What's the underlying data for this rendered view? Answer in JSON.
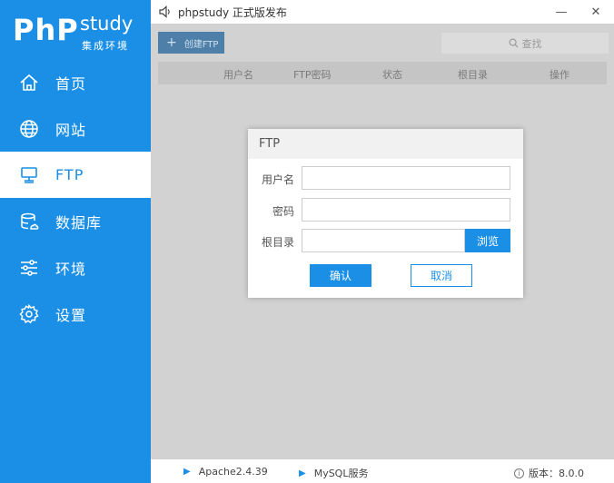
{
  "sidebar": {
    "logo": {
      "brand": "PhP",
      "product": "study",
      "tagline": "集成环境"
    },
    "items": [
      {
        "label": "首页",
        "icon": "home-icon"
      },
      {
        "label": "网站",
        "icon": "globe-icon"
      },
      {
        "label": "FTP",
        "icon": "monitor-icon"
      },
      {
        "label": "数据库",
        "icon": "database-icon"
      },
      {
        "label": "环境",
        "icon": "sliders-icon"
      },
      {
        "label": "设置",
        "icon": "gear-icon"
      }
    ],
    "active_index": 2
  },
  "titlebar": {
    "title": "phpstudy 正式版发布",
    "minimize": "—",
    "close": "✕"
  },
  "toolbar": {
    "create_label": "创建FTP",
    "search_placeholder": "查找"
  },
  "table": {
    "headers": [
      "用户名",
      "FTP密码",
      "状态",
      "根目录",
      "操作"
    ]
  },
  "dialog": {
    "title": "FTP",
    "fields": [
      {
        "label": "用户名",
        "value": ""
      },
      {
        "label": "密码",
        "value": ""
      },
      {
        "label": "根目录",
        "value": ""
      }
    ],
    "browse_label": "浏览",
    "confirm_label": "确认",
    "cancel_label": "取消"
  },
  "statusbar": {
    "services": [
      {
        "name": "Apache2.4.39"
      },
      {
        "name": "MySQL服务"
      }
    ],
    "version": "版本：8.0.0"
  },
  "colors": {
    "accent": "#1b8fe6",
    "overlay": "#d2d2d2"
  }
}
